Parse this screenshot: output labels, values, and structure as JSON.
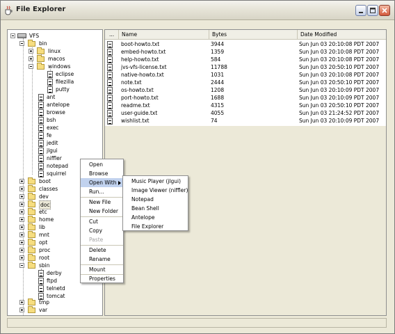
{
  "window": {
    "title": "File Explorer"
  },
  "colors": {
    "menu_hover": "#c1d2ee",
    "folder": "#f6dd80",
    "disabled_text": "#a0a0a0"
  },
  "tree": {
    "root": "VFS",
    "bin": "bin",
    "linux": "linux",
    "macos": "macos",
    "windows": "windows",
    "eclipse": "eclipse",
    "filezilla": "filezilla",
    "putty": "putty",
    "ant": "ant",
    "antelope": "antelope",
    "browse": "browse",
    "bsh": "bsh",
    "exec": "exec",
    "fe": "fe",
    "jedit": "jedit",
    "jlgui": "jlgui",
    "niffler": "niffler",
    "notepad": "notepad",
    "squirrel": "squirrel",
    "boot": "boot",
    "classes": "classes",
    "dev": "dev",
    "doc": "doc",
    "etc": "etc",
    "home": "home",
    "lib": "lib",
    "mnt": "mnt",
    "opt": "opt",
    "proc": "proc",
    "root_dir": "root",
    "sbin": "sbin",
    "derby": "derby",
    "ftpd": "ftpd",
    "telnetd": "telnetd",
    "tomcat": "tomcat",
    "tmp": "tmp",
    "var": "var"
  },
  "table": {
    "columns": {
      "c0": "...",
      "name": "Name",
      "bytes": "Bytes",
      "date": "Date Modified"
    },
    "rows": [
      {
        "name": "boot-howto.txt",
        "bytes": "3944",
        "date": "Sun Jun 03 20:10:08 PDT 2007"
      },
      {
        "name": "embed-howto.txt",
        "bytes": "1359",
        "date": "Sun Jun 03 20:10:08 PDT 2007"
      },
      {
        "name": "help-howto.txt",
        "bytes": "584",
        "date": "Sun Jun 03 20:10:08 PDT 2007"
      },
      {
        "name": "jvs-vfs-license.txt",
        "bytes": "11788",
        "date": "Sun Jun 03 20:50:10 PDT 2007"
      },
      {
        "name": "native-howto.txt",
        "bytes": "1031",
        "date": "Sun Jun 03 20:10:08 PDT 2007"
      },
      {
        "name": "note.txt",
        "bytes": "2444",
        "date": "Sun Jun 03 20:50:10 PDT 2007"
      },
      {
        "name": "os-howto.txt",
        "bytes": "1208",
        "date": "Sun Jun 03 20:10:09 PDT 2007"
      },
      {
        "name": "port-howto.txt",
        "bytes": "1688",
        "date": "Sun Jun 03 20:10:09 PDT 2007"
      },
      {
        "name": "readme.txt",
        "bytes": "4315",
        "date": "Sun Jun 03 20:50:10 PDT 2007"
      },
      {
        "name": "user-guide.txt",
        "bytes": "4055",
        "date": "Sun Jun 03 21:24:52 PDT 2007"
      },
      {
        "name": "wishlist.txt",
        "bytes": "74",
        "date": "Sun Jun 03 20:10:09 PDT 2007"
      }
    ]
  },
  "context_menu": {
    "open": "Open",
    "browse": "Browse",
    "open_with": "Open With",
    "run": "Run...",
    "new_file": "New File",
    "new_folder": "New Folder",
    "cut": "Cut",
    "copy": "Copy",
    "paste": "Paste",
    "delete": "Delete",
    "rename": "Rename",
    "mount": "Mount",
    "properties": "Properties"
  },
  "open_with_menu": {
    "music_player": "Music Player (jlgui)",
    "image_viewer": "Image Viewer (niffler)",
    "notepad": "Notepad",
    "bean_shell": "Bean Shell",
    "antelope": "Antelope",
    "file_explorer": "File Explorer"
  },
  "statusbar": {
    "text": ""
  }
}
